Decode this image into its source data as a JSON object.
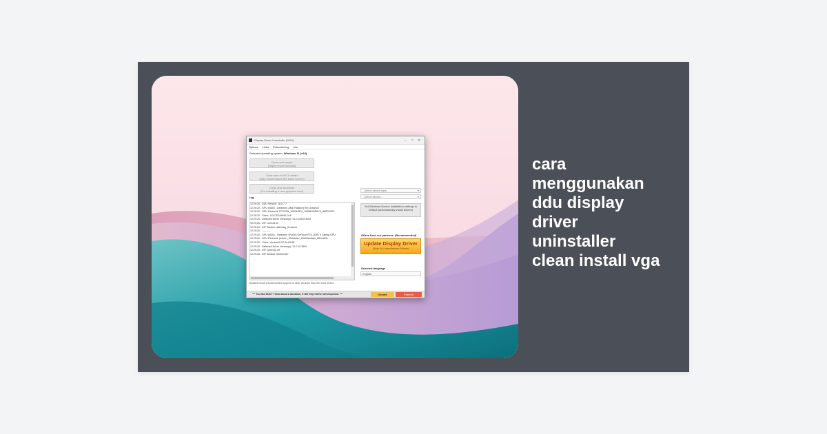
{
  "article": {
    "title_lines": [
      "cara",
      "menggunakan",
      "ddu display",
      "driver",
      "uninstaller",
      "clean install vga"
    ]
  },
  "colors": {
    "page_bg": "#f3f4f6",
    "card_bg": "#4b4f57",
    "title_text": "#ffffff",
    "sky_pink": "#fbe1e6",
    "dune_teal": "#1e9aa5",
    "dune_lavender": "#c6a6d6",
    "update_button": "#f2a81a"
  },
  "ddu_window": {
    "title": "Display Driver Uninstaller (DDU)",
    "controls": [
      "–",
      "□",
      "✕"
    ],
    "menu": [
      "Options",
      "Links",
      "Extended log",
      "Info"
    ],
    "os_label": "Detected operating system:",
    "os_value": "Windows 11 (x64)",
    "buttons": [
      {
        "main": "Clean and restart",
        "sub": "(Highly recommended)"
      },
      {
        "main": "Clean and do NOT restart",
        "sub": "(May cause issues like black screen)"
      },
      {
        "main": "Clean and shutdown",
        "sub": "(For installing a new graphics card)"
      }
    ],
    "device_type_placeholder": "- Select device type -",
    "device_placeholder": "- Select device -",
    "log_title": "Log",
    "log_lines": [
      "12:29:20 - DDU Version: 18.0.7.7",
      "12:29:20 - GPU #0000 - Detected: AMD Radeon(TM) Graphics",
      "12:29:20 - GPU DeviceId: PCI\\VEN_1002&DEV_1638&SUBSYS_88ED103C",
      "12:29:20 - Vbios: 113-CEZANNE-018",
      "12:29:20 - Detected Driver Version(s): 31.0.12002.4002",
      "12:29:20 - INF: oem18.inf",
      "12:29:20 - INF Section: ati2mtag_Cezanne",
      "12:29:20 - ----------",
      "12:29:20 - GPU #0001 - Detected: NVIDIA GeForce RTX 3050 Ti Laptop GPU",
      "12:29:20 - GPU DeviceId: pci\\ven_10de&dev_25a0&subsys_88ed103c",
      "12:29:20 - Vbios: Version90.07.3a.00.88",
      "12:29:20 - Detected Driver Version(s): 31.0.15.3699",
      "12:29:20 - INF: oem132.inf",
      "12:29:20 - INF Section: Section117"
    ],
    "right_button": "Set Windows Device Installation settings to Default (automatically install drivers)",
    "offers_label": "Offers from our partners: (Recommended)",
    "update_main": "Update Display Driver",
    "update_sub": "(Work ALL manufacturer Drivers)",
    "language_label": "Selected language",
    "language_value": "English",
    "footnote": "Updates found! Expect limited support on older versions than the most recent.",
    "bottom_message": "*** You like DDU? Think about a donation, it will help further development. ***",
    "donate_label": "Donate",
    "patreon_label": "Patreon"
  }
}
